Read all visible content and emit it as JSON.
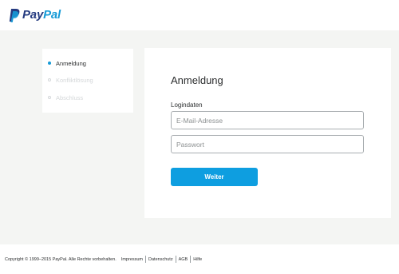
{
  "brand": {
    "pay": "Pay",
    "pal": "Pal",
    "colors": {
      "pay": "#253b80",
      "pal": "#179bd7",
      "accent": "#0e9ee0"
    },
    "icon": "paypal-p-icon"
  },
  "steps": [
    {
      "label": "Anmeldung",
      "state": "active"
    },
    {
      "label": "Konfliktlösung",
      "state": "inactive"
    },
    {
      "label": "Abschluss",
      "state": "inactive"
    }
  ],
  "login": {
    "title": "Anmeldung",
    "section_label": "Logindaten",
    "email_placeholder": "E-Mail-Adresse",
    "email_value": "",
    "password_placeholder": "Passwort",
    "password_value": "",
    "submit_label": "Weiter"
  },
  "footer": {
    "copyright": "Copyright © 1999–2015 PayPal. Alle Rechte vorbehalten.",
    "links": [
      "Impressum",
      "Datenschutz",
      "AGB",
      "Hilfe"
    ]
  }
}
